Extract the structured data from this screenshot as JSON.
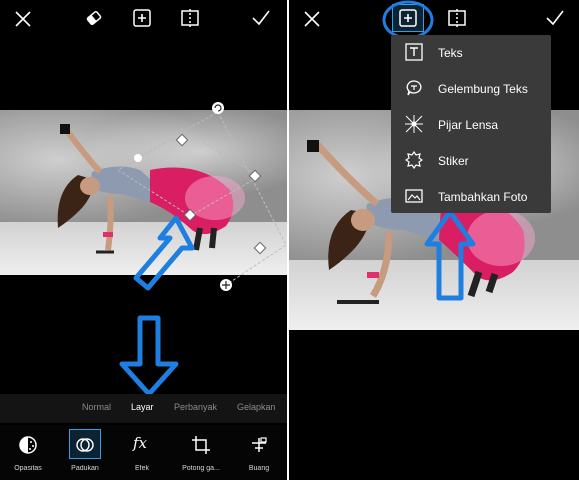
{
  "left_panel": {
    "blend_modes": [
      "Normal",
      "Layar",
      "Perbanyak",
      "Gelapkan"
    ],
    "selected_blend_mode": "Layar",
    "tools": [
      {
        "label": "Opasitas",
        "icon": "opacity-icon"
      },
      {
        "label": "Padukan",
        "icon": "blend-icon",
        "active": true
      },
      {
        "label": "Efek",
        "icon": "effects-icon"
      },
      {
        "label": "Potong ga...",
        "icon": "crop-icon"
      },
      {
        "label": "Buang",
        "icon": "eraser-tool-icon"
      }
    ],
    "top_icons": [
      "close-icon",
      "eraser-icon",
      "add-icon",
      "compare-icon",
      "check-icon"
    ]
  },
  "right_panel": {
    "menu_items": [
      {
        "label": "Teks",
        "icon": "text-icon"
      },
      {
        "label": "Gelembung Teks",
        "icon": "speech-bubble-icon"
      },
      {
        "label": "Pijar Lensa",
        "icon": "lens-flare-icon"
      },
      {
        "label": "Stiker",
        "icon": "sticker-icon"
      },
      {
        "label": "Tambahkan Foto",
        "icon": "add-photo-icon"
      }
    ],
    "top_icons": [
      "close-icon",
      "add-icon",
      "compare-icon",
      "check-icon"
    ]
  },
  "colors": {
    "accent": "#2f9fe6",
    "annotation_arrow": "#1e7fe0",
    "background": "#000000",
    "menu_background": "#3a3a3a"
  },
  "fx_glyph": "fx"
}
